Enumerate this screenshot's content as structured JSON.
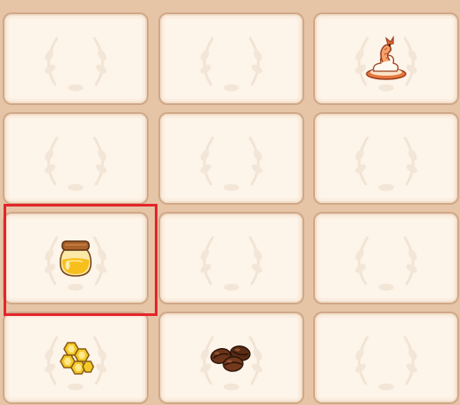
{
  "inventory": {
    "columns": 3,
    "rows": 4,
    "selected_slot": 6,
    "selection_color": "#e3262b",
    "slot_background": "#fdf4ea",
    "panel_background": "#e6c4a6",
    "slots": [
      {
        "item": null
      },
      {
        "item": null
      },
      {
        "item": "shrimp-cream-dessert-icon"
      },
      {
        "item": null
      },
      {
        "item": null
      },
      {
        "item": null
      },
      {
        "item": "honey-jar-icon"
      },
      {
        "item": null
      },
      {
        "item": null
      },
      {
        "item": "honeycomb-icon"
      },
      {
        "item": "coffee-beans-icon"
      },
      {
        "item": null
      }
    ]
  }
}
